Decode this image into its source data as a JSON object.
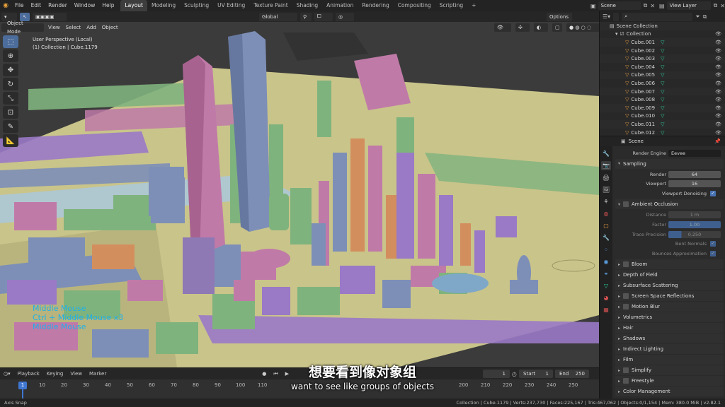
{
  "topbar": {
    "menus": [
      "File",
      "Edit",
      "Render",
      "Window",
      "Help"
    ],
    "workspaces": [
      "Layout",
      "Modeling",
      "Sculpting",
      "UV Editing",
      "Texture Paint",
      "Shading",
      "Animation",
      "Rendering",
      "Compositing",
      "Scripting"
    ],
    "active_workspace": "Layout",
    "add_tab": "+",
    "scene": "Scene",
    "view_layer": "View Layer"
  },
  "viewport": {
    "mode": "Object Mode",
    "menus": [
      "View",
      "Select",
      "Add",
      "Object"
    ],
    "transform_orientation": "Global",
    "options_label": "Options",
    "info_line1": "User Perspective (Local)",
    "info_line2": "(1) Collection | Cube.1179",
    "nav_hints": [
      "Middle Mouse",
      "Ctrl + Middle Mouse x3",
      "Middle Mouse"
    ]
  },
  "subtitles": {
    "chinese": "想要看到像对象组",
    "english": "want to see like groups of objects"
  },
  "outliner": {
    "root": "Scene Collection",
    "collection": "Collection",
    "items": [
      "Cube.001",
      "Cube.002",
      "Cube.003",
      "Cube.004",
      "Cube.005",
      "Cube.006",
      "Cube.007",
      "Cube.008",
      "Cube.009",
      "Cube.010",
      "Cube.011",
      "Cube.012"
    ]
  },
  "properties": {
    "header": "Scene",
    "render_engine_label": "Render Engine",
    "render_engine": "Eevee",
    "sampling": "Sampling",
    "render_label": "Render",
    "render_value": "64",
    "viewport_label": "Viewport",
    "viewport_value": "16",
    "viewport_denoising": "Viewport Denoising",
    "ao": "Ambient Occlusion",
    "distance_label": "Distance",
    "distance_value": "1 m",
    "factor_label": "Factor",
    "factor_value": "1.00",
    "trace_label": "Trace Precision",
    "trace_value": "0.250",
    "bent_normals": "Bent Normals",
    "bounces": "Bounces Approximation",
    "panels": [
      "Bloom",
      "Depth of Field",
      "Subsurface Scattering",
      "Screen Space Reflections",
      "Motion Blur",
      "Volumetrics",
      "Hair",
      "Shadows",
      "Indirect Lighting",
      "Film",
      "Simplify",
      "Freestyle",
      "Color Management"
    ]
  },
  "timeline": {
    "menus": [
      "Playback",
      "Keying",
      "View",
      "Marker"
    ],
    "current_frame": "1",
    "start_label": "Start",
    "start_value": "1",
    "end_label": "End",
    "end_value": "250",
    "ticks": [
      "10",
      "20",
      "30",
      "40",
      "50",
      "60",
      "70",
      "80",
      "90",
      "100",
      "110",
      "200",
      "210",
      "220",
      "230",
      "240",
      "250"
    ],
    "playhead": "1"
  },
  "statusbar": {
    "left": "Axis Snap",
    "right": "Collection | Cube.1179 | Verts:237,730 | Faces:225,167 | Tris:467,062 | Objects:0/1,154 | Mem: 380.0 MiB | v2.82.1"
  },
  "colors": {
    "ground": "#c9c48a",
    "pink": "#c07aa8",
    "blue": "#7d8fb7",
    "green": "#7fb37d",
    "orange": "#d38e5e",
    "purple": "#9a79c6",
    "accent": "#4772b3"
  }
}
